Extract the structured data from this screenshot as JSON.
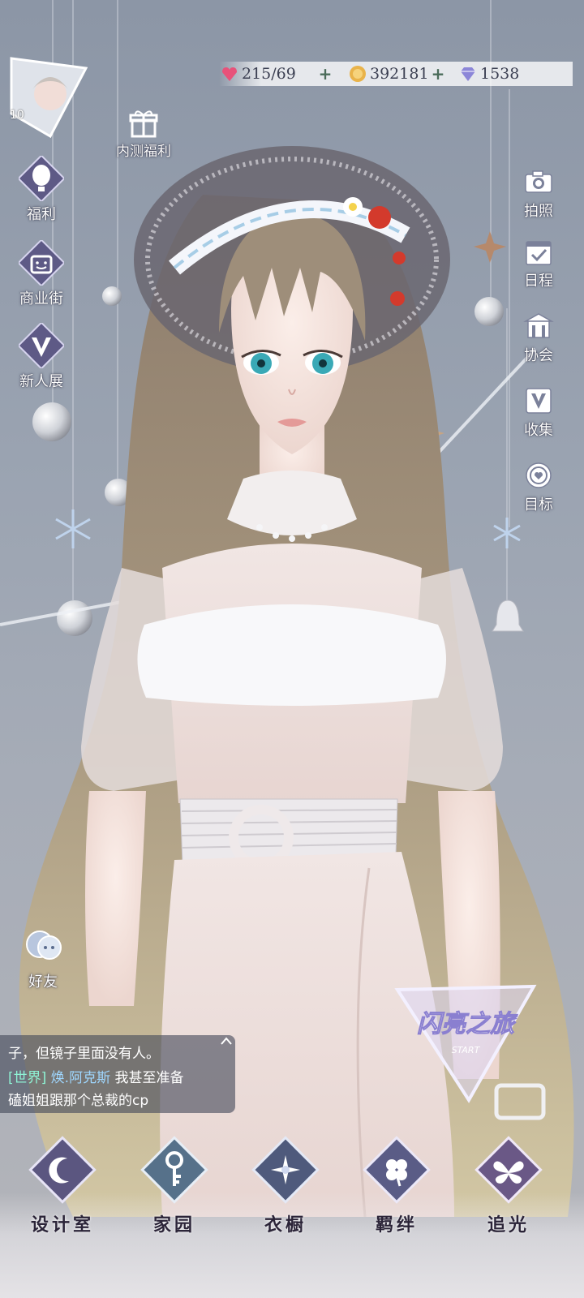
{
  "player": {
    "level": "10",
    "avatar_icon": "player-portrait"
  },
  "resources": {
    "stamina": "215/69",
    "gold": "392181",
    "diamonds": "1538"
  },
  "left_menu": {
    "beta_gift": "内测福利",
    "welfare": "福利",
    "shopping_street": "商业街",
    "newcomer_show": "新人展"
  },
  "right_menu": {
    "photo": "拍照",
    "schedule": "日程",
    "guild": "协会",
    "collection": "收集",
    "goals": "目标"
  },
  "friends": "好友",
  "chat": {
    "line1": "子，但镜子里面没有人。",
    "line2_channel": "[世界]",
    "line2_name": "焕.阿克斯",
    "line2_text": "我甚至准备",
    "line3": "磕姐姐跟那个总裁的cp"
  },
  "event_banner": {
    "title": "闪亮之旅",
    "sub": "START"
  },
  "bottom_nav": {
    "design_room": "设计室",
    "home": "家园",
    "wardrobe": "衣橱",
    "bonds": "羁绊",
    "pursue_light": "追光"
  },
  "colors": {
    "accent": "#8ef2d4",
    "name": "#9fd7ff",
    "nav_text": "#2b2438"
  }
}
